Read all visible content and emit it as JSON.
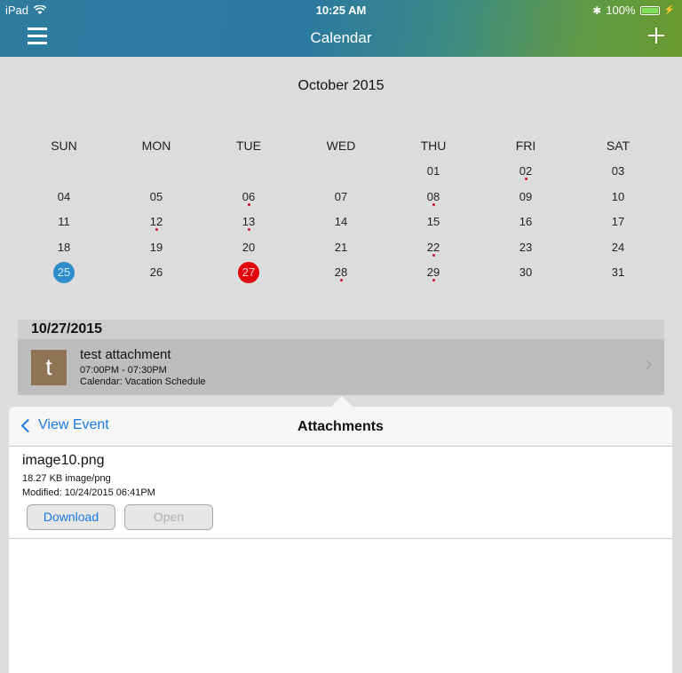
{
  "status": {
    "device": "iPad",
    "time": "10:25 AM",
    "battery": "100%"
  },
  "header": {
    "title": "Calendar"
  },
  "calendar": {
    "month_label": "October 2015",
    "weekdays": [
      "SUN",
      "MON",
      "TUE",
      "WED",
      "THU",
      "FRI",
      "SAT"
    ],
    "weeks": [
      [
        "",
        "",
        "",
        "",
        "01",
        "02",
        "03"
      ],
      [
        "04",
        "05",
        "06",
        "07",
        "08",
        "09",
        "10"
      ],
      [
        "11",
        "12",
        "13",
        "14",
        "15",
        "16",
        "17"
      ],
      [
        "18",
        "19",
        "20",
        "21",
        "22",
        "23",
        "24"
      ],
      [
        "25",
        "26",
        "27",
        "28",
        "29",
        "30",
        "31"
      ]
    ],
    "event_days": [
      "02",
      "06",
      "08",
      "12",
      "13",
      "22",
      "27",
      "28",
      "29"
    ],
    "today": "25",
    "selected": "27",
    "colors": {
      "today": "#2e8cc8",
      "selected": "#e2060c",
      "event_dot": "#c8102e"
    }
  },
  "events": {
    "date": "10/27/2015",
    "items": [
      {
        "thumb": "t",
        "title": "test attachment",
        "time": "07:00PM - 07:30PM",
        "calendar": "Calendar: Vacation Schedule"
      }
    ]
  },
  "attachments": {
    "back_label": "View Event",
    "title": "Attachments",
    "file": {
      "name": "image10.png",
      "meta": "18.27 KB image/png",
      "modified": "Modified: 10/24/2015 06:41PM"
    },
    "download_label": "Download",
    "open_label": "Open"
  }
}
